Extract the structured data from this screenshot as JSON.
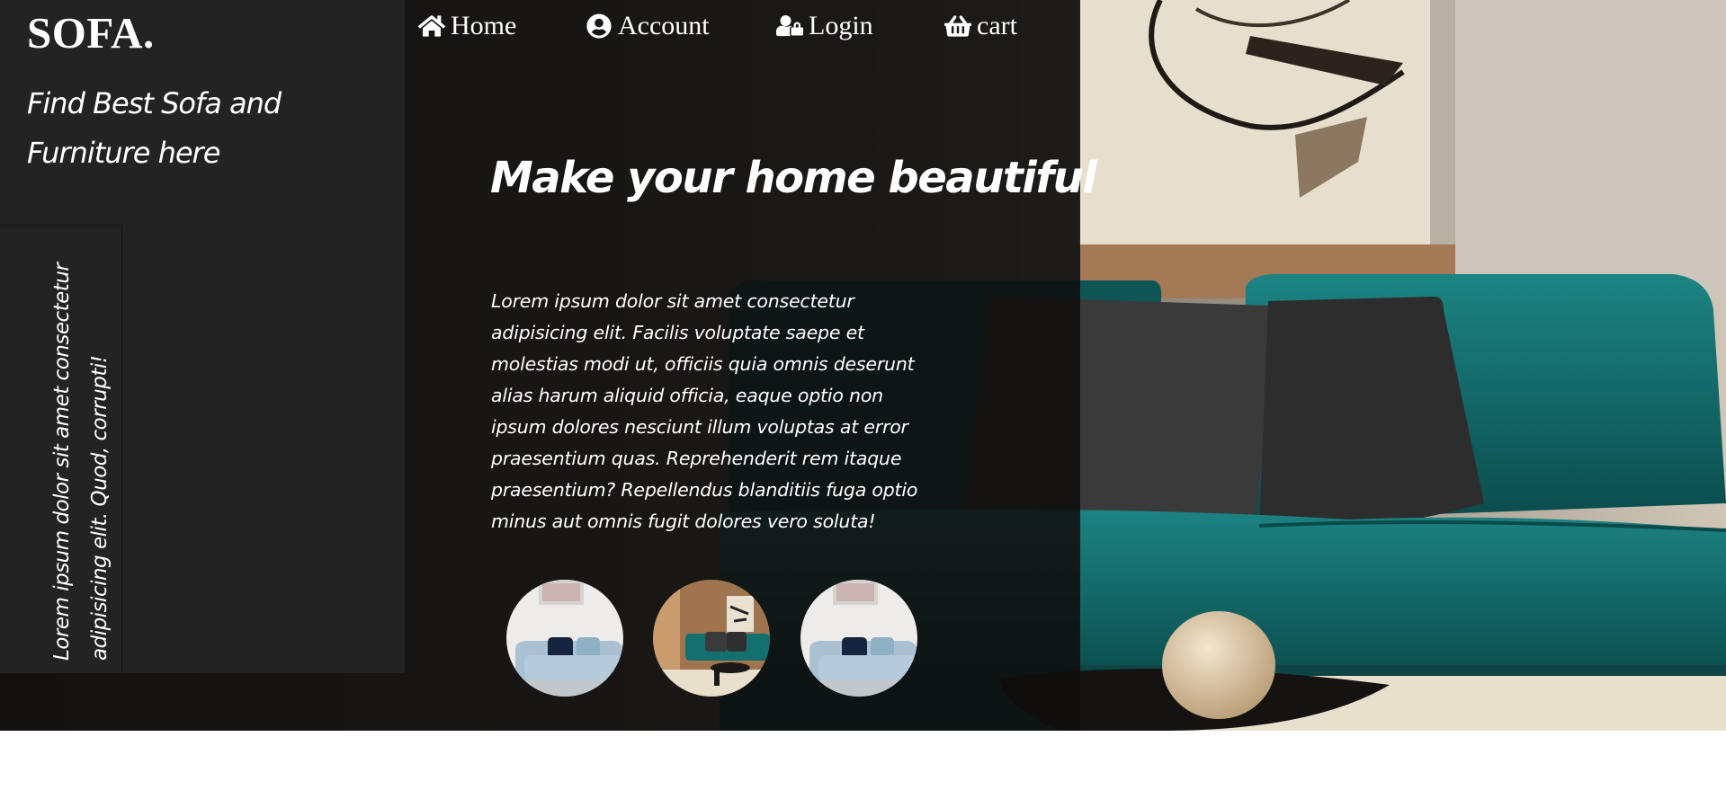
{
  "brand": {
    "name": "SOFA."
  },
  "tagline": "Find Best Sofa and Furniture here",
  "side_text": "Lorem ipsum dolor sit amet consectetur adipisicing elit. Quod, corrupti!",
  "nav": {
    "items": [
      {
        "label": "Home",
        "icon": "home-icon"
      },
      {
        "label": "Account",
        "icon": "user-circle-icon"
      },
      {
        "label": "Login",
        "icon": "user-lock-icon"
      },
      {
        "label": "cart",
        "icon": "shopping-basket-icon"
      }
    ]
  },
  "hero": {
    "headline": "Make your home beautiful",
    "body": "Lorem ipsum dolor sit amet consectetur adipisicing elit. Facilis voluptate saepe et molestias modi ut, officiis quia omnis deserunt alias harum aliquid officia, eaque optio non ipsum dolores nesciunt illum voluptas at error praesentium quas. Reprehenderit rem itaque praesentium? Repellendus blanditiis fuga optio minus aut omnis fugit dolores vero soluta!"
  },
  "colors": {
    "sofa_teal": "#13706f",
    "panel_dark": "#232323",
    "overlay": "#0f0e0d",
    "text": "#ffffff"
  }
}
